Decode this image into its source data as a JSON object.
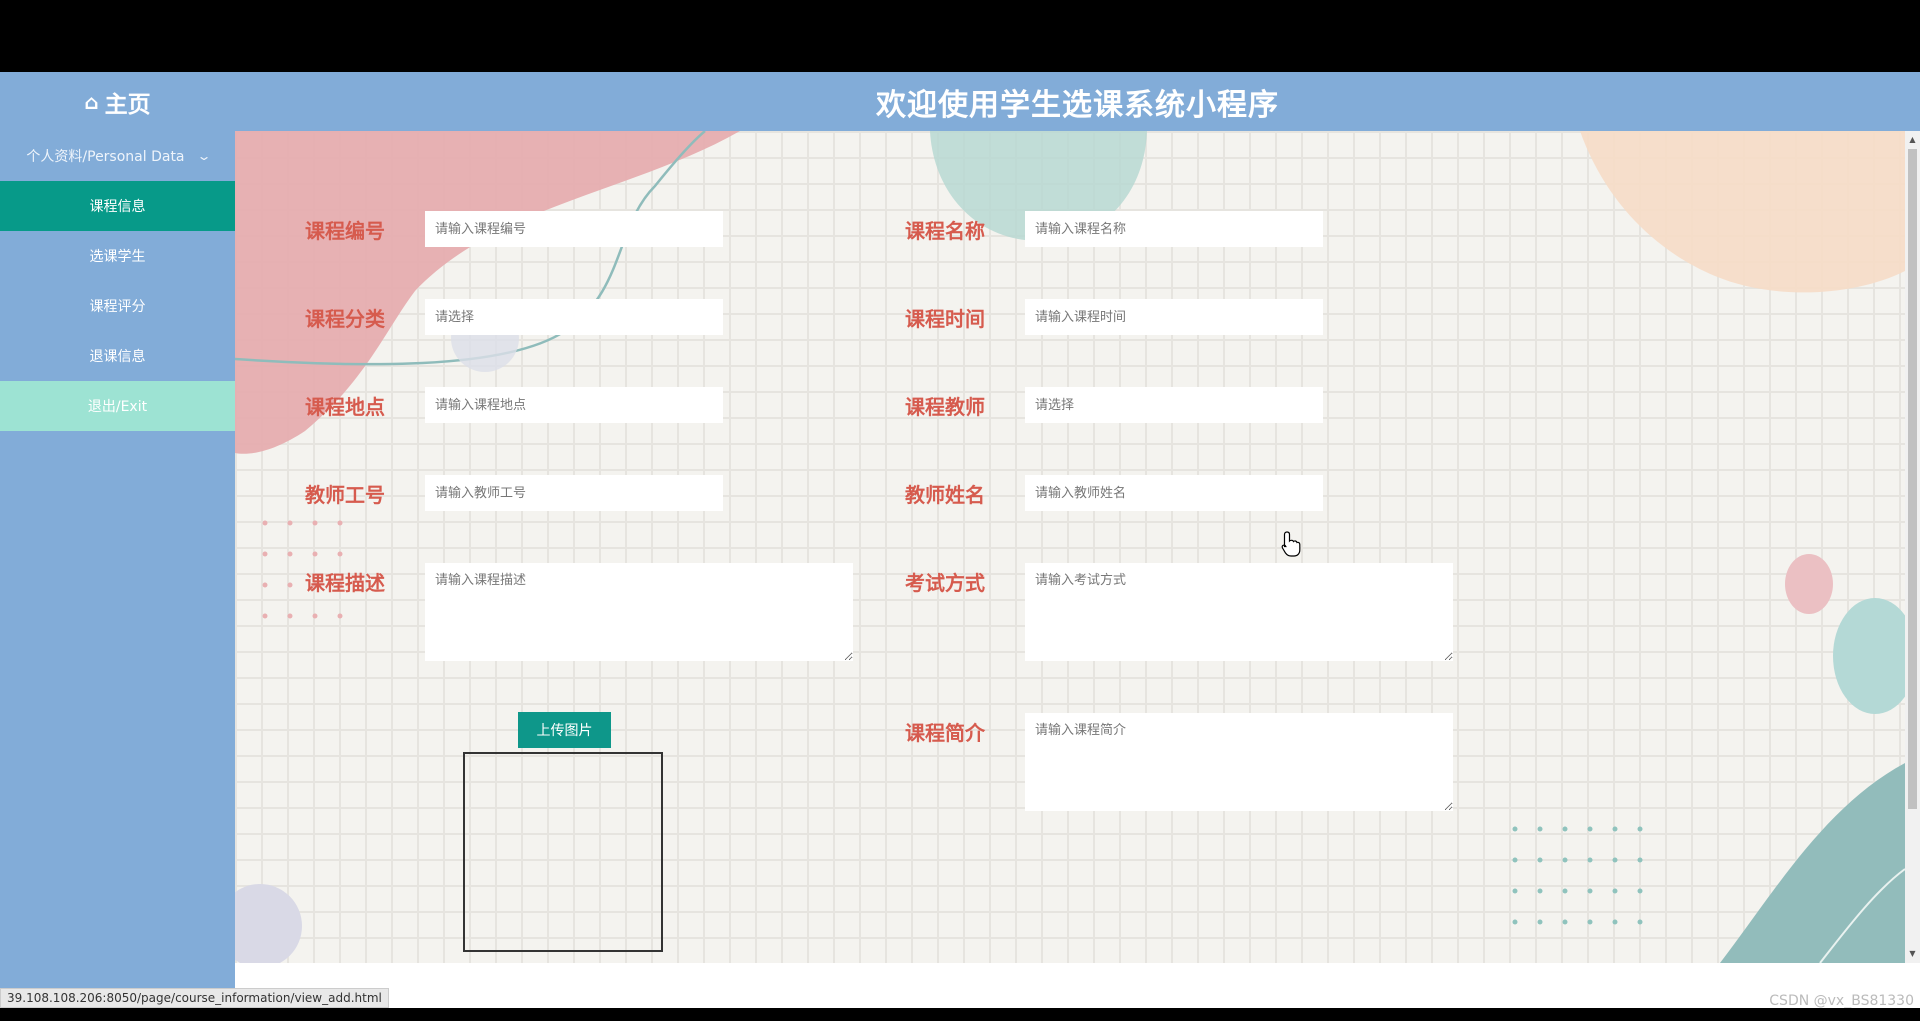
{
  "header": {
    "home_label": "主页",
    "home_icon": "home-icon",
    "title": "欢迎使用学生选课系统小程序"
  },
  "sidebar": {
    "items": [
      {
        "label": "个人资料/Personal Data",
        "expandable": true
      },
      {
        "label": "课程信息",
        "active": true
      },
      {
        "label": "选课学生"
      },
      {
        "label": "课程评分"
      },
      {
        "label": "退课信息"
      },
      {
        "label": "退出/Exit"
      }
    ]
  },
  "form": {
    "course_code": {
      "label": "课程编号",
      "placeholder": "请输入课程编号"
    },
    "course_name": {
      "label": "课程名称",
      "placeholder": "请输入课程名称"
    },
    "course_category": {
      "label": "课程分类",
      "placeholder": "请选择"
    },
    "course_time": {
      "label": "课程时间",
      "placeholder": "请输入课程时间"
    },
    "course_location": {
      "label": "课程地点",
      "placeholder": "请输入课程地点"
    },
    "course_teacher": {
      "label": "课程教师",
      "placeholder": "请选择"
    },
    "teacher_id": {
      "label": "教师工号",
      "placeholder": "请输入教师工号"
    },
    "teacher_name": {
      "label": "教师姓名",
      "placeholder": "请输入教师姓名"
    },
    "course_description": {
      "label": "课程描述",
      "placeholder": "请输入课程描述"
    },
    "exam_method": {
      "label": "考试方式",
      "placeholder": "请输入考试方式"
    },
    "course_intro": {
      "label": "课程简介",
      "placeholder": "请输入课程简介"
    },
    "upload_label": "上传图片"
  },
  "status_bar": {
    "url": "39.108.108.206:8050/page/course_information/view_add.html"
  },
  "watermark": "CSDN @vx_BS81330",
  "colors": {
    "header_bg": "#82acd8",
    "sidebar_active": "#079a89",
    "sidebar_exit": "#9de3d3",
    "label_red": "#d65b4e",
    "upload_button": "#0e978a"
  }
}
